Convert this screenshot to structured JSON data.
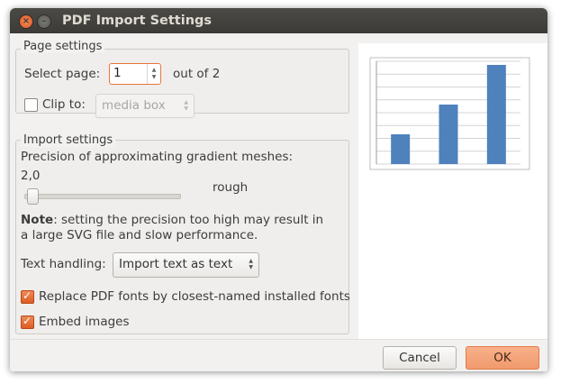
{
  "window": {
    "title": "PDF Import Settings"
  },
  "page_settings": {
    "label": "Page settings",
    "select_page_label": "Select page:",
    "page_value": "1",
    "out_of_label": "out of 2",
    "clip_to_label": "Clip to:",
    "clip_to_checked": false,
    "clip_to_value": "media box"
  },
  "import_settings": {
    "label": "Import settings",
    "precision_label": "Precision of approximating gradient meshes:",
    "precision_value": "2,0",
    "precision_slider_fraction": 0.02,
    "rough_label": "rough",
    "note_bold": "Note",
    "note_text_line1": ": setting the precision too high may result in",
    "note_text_line2": "a large SVG file and slow performance.",
    "text_handling_label": "Text handling:",
    "text_handling_value": "Import text as text",
    "replace_fonts_label": "Replace PDF fonts by closest-named installed fonts",
    "replace_fonts_checked": true,
    "embed_images_label": "Embed images",
    "embed_images_checked": true
  },
  "preview": {
    "bar_values": [
      0.3,
      0.6,
      1.0
    ],
    "bar_color": "#4f81bd"
  },
  "buttons": {
    "cancel": "Cancel",
    "ok": "OK"
  },
  "colors": {
    "accent": "#e0571c",
    "ok_button": "#f19a6d"
  }
}
